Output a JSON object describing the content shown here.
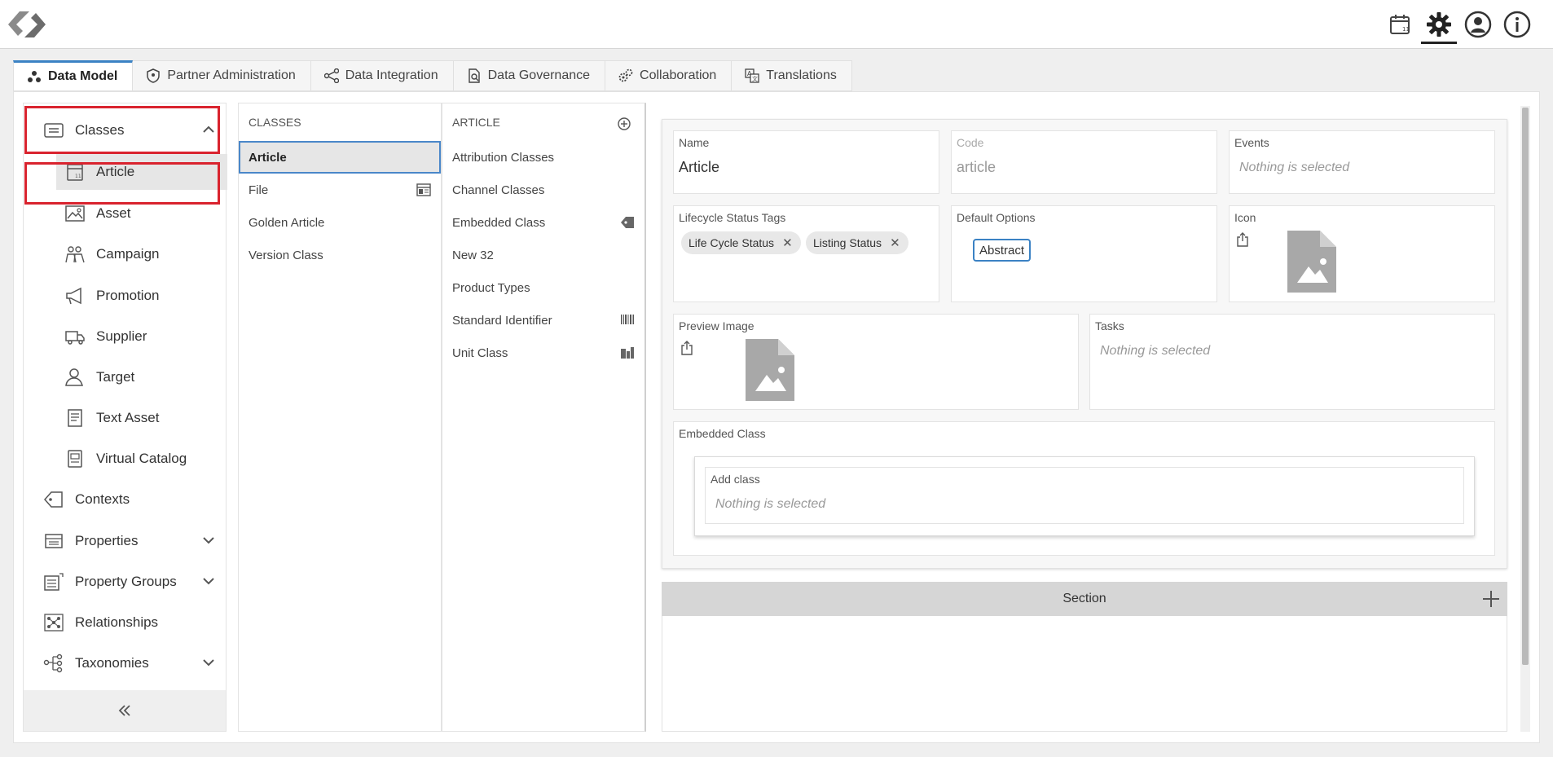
{
  "top_icons": [
    "calendar-icon",
    "gear-icon",
    "user-icon",
    "info-icon"
  ],
  "tabs": [
    {
      "label": "Data Model",
      "icon": "recycle-icon",
      "active": true
    },
    {
      "label": "Partner Administration",
      "icon": "shield-icon"
    },
    {
      "label": "Data Integration",
      "icon": "share-icon"
    },
    {
      "label": "Data Governance",
      "icon": "doc-search-icon"
    },
    {
      "label": "Collaboration",
      "icon": "gears-icon"
    },
    {
      "label": "Translations",
      "icon": "translate-icon"
    }
  ],
  "nav": {
    "classes": "Classes",
    "article": "Article",
    "asset": "Asset",
    "campaign": "Campaign",
    "promotion": "Promotion",
    "supplier": "Supplier",
    "target": "Target",
    "text_asset": "Text Asset",
    "virtual_catalog": "Virtual Catalog",
    "contexts": "Contexts",
    "properties": "Properties",
    "property_groups": "Property Groups",
    "relationships": "Relationships",
    "taxonomies": "Taxonomies"
  },
  "classes_col": {
    "header": "CLASSES",
    "items": [
      "Article",
      "File",
      "Golden Article",
      "Version Class"
    ]
  },
  "article_col": {
    "header": "ARTICLE",
    "items": [
      "Attribution Classes",
      "Channel Classes",
      "Embedded Class",
      "New 32",
      "Product Types",
      "Standard Identifier",
      "Unit Class"
    ]
  },
  "detail": {
    "name_label": "Name",
    "name_value": "Article",
    "code_label": "Code",
    "code_value": "article",
    "events_label": "Events",
    "events_placeholder": "Nothing is selected",
    "lifecycle_label": "Lifecycle Status Tags",
    "chips": [
      "Life Cycle Status",
      "Listing Status"
    ],
    "default_options_label": "Default Options",
    "abstract_label": "Abstract",
    "icon_label": "Icon",
    "preview_label": "Preview Image",
    "tasks_label": "Tasks",
    "tasks_placeholder": "Nothing is selected",
    "embedded_label": "Embedded Class",
    "add_class_label": "Add class",
    "add_class_placeholder": "Nothing is selected",
    "section_label": "Section"
  }
}
